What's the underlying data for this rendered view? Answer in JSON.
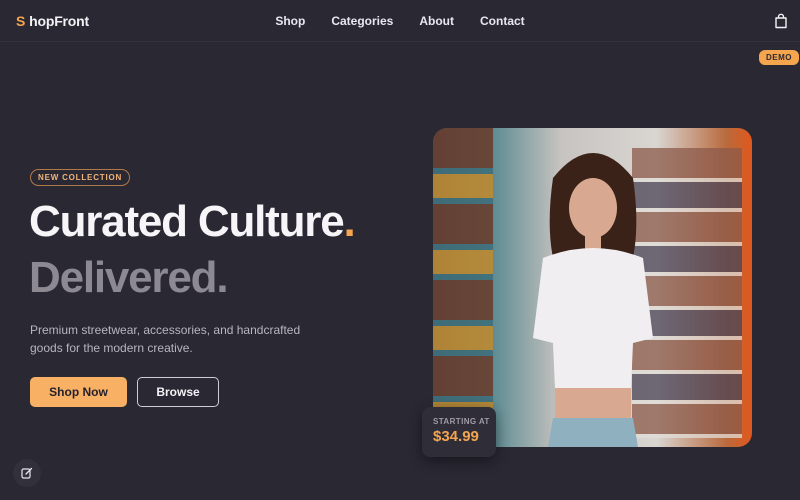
{
  "nav": {
    "logo_mark": "S",
    "logo_text": "hopFront",
    "items": [
      {
        "label": "Shop"
      },
      {
        "label": "Categories"
      },
      {
        "label": "About"
      },
      {
        "label": "Contact"
      }
    ],
    "cart_icon": "shopping-bag-icon"
  },
  "badge": {
    "label": "DEMO"
  },
  "hero": {
    "eyebrow": "NEW COLLECTION",
    "headline_line1": "Curated Culture",
    "headline_line2": "Delivered",
    "headline_dot": ".",
    "description": "Premium streetwear, accessories, and handcrafted goods for the modern creative.",
    "primary_button": "Shop Now",
    "secondary_button": "Browse"
  },
  "price_card": {
    "label": "STARTING AT",
    "value": "$34.99"
  },
  "corner_widget": {
    "icon": "edit-icon"
  },
  "colors": {
    "background": "#2a2833",
    "accent": "#f5a54e",
    "primary_button": "#f7b064",
    "muted_heading": "#8c8993"
  }
}
